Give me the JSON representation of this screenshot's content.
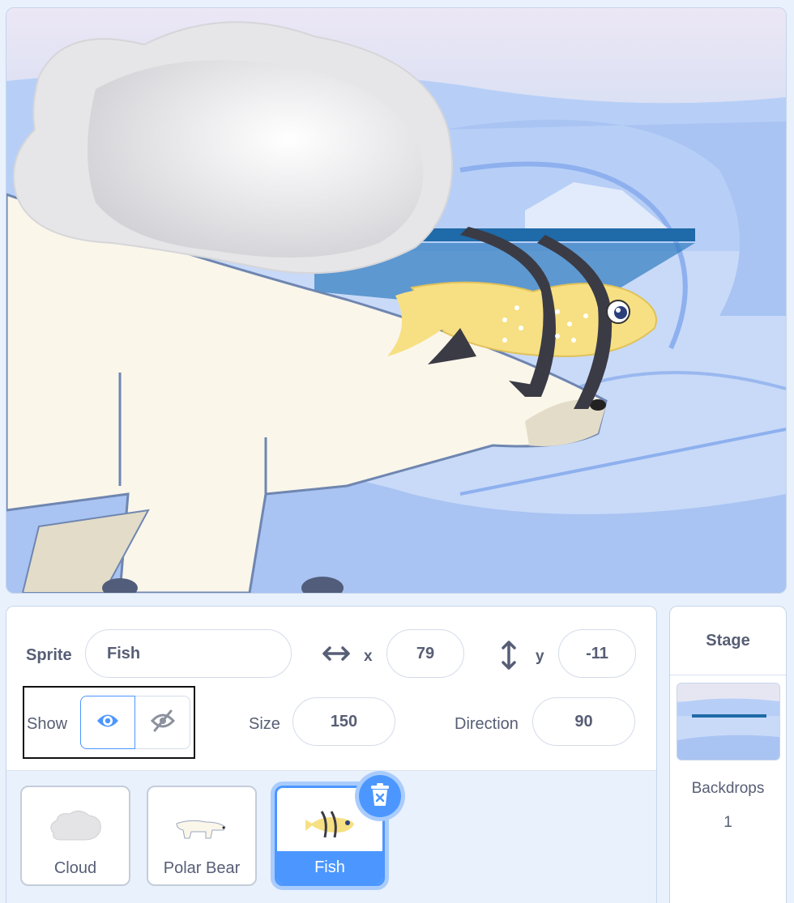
{
  "sprite_info": {
    "sprite_label": "Sprite",
    "sprite_name": "Fish",
    "x_label": "x",
    "x_value": "79",
    "y_label": "y",
    "y_value": "-11",
    "show_label": "Show",
    "show_state": "visible",
    "size_label": "Size",
    "size_value": "150",
    "direction_label": "Direction",
    "direction_value": "90"
  },
  "sprites": [
    {
      "name": "Cloud",
      "icon": "cloud-icon",
      "selected": false
    },
    {
      "name": "Polar Bear",
      "icon": "polar-bear-icon",
      "selected": false
    },
    {
      "name": "Fish",
      "icon": "fish-icon",
      "selected": true
    }
  ],
  "stage_panel": {
    "title": "Stage",
    "backdrops_label": "Backdrops",
    "backdrops_count": "1"
  },
  "colors": {
    "accent": "#4c97ff",
    "accent_glow": "#a9ccfc",
    "text": "#575e75",
    "panel_bg": "#e9f1fc"
  }
}
